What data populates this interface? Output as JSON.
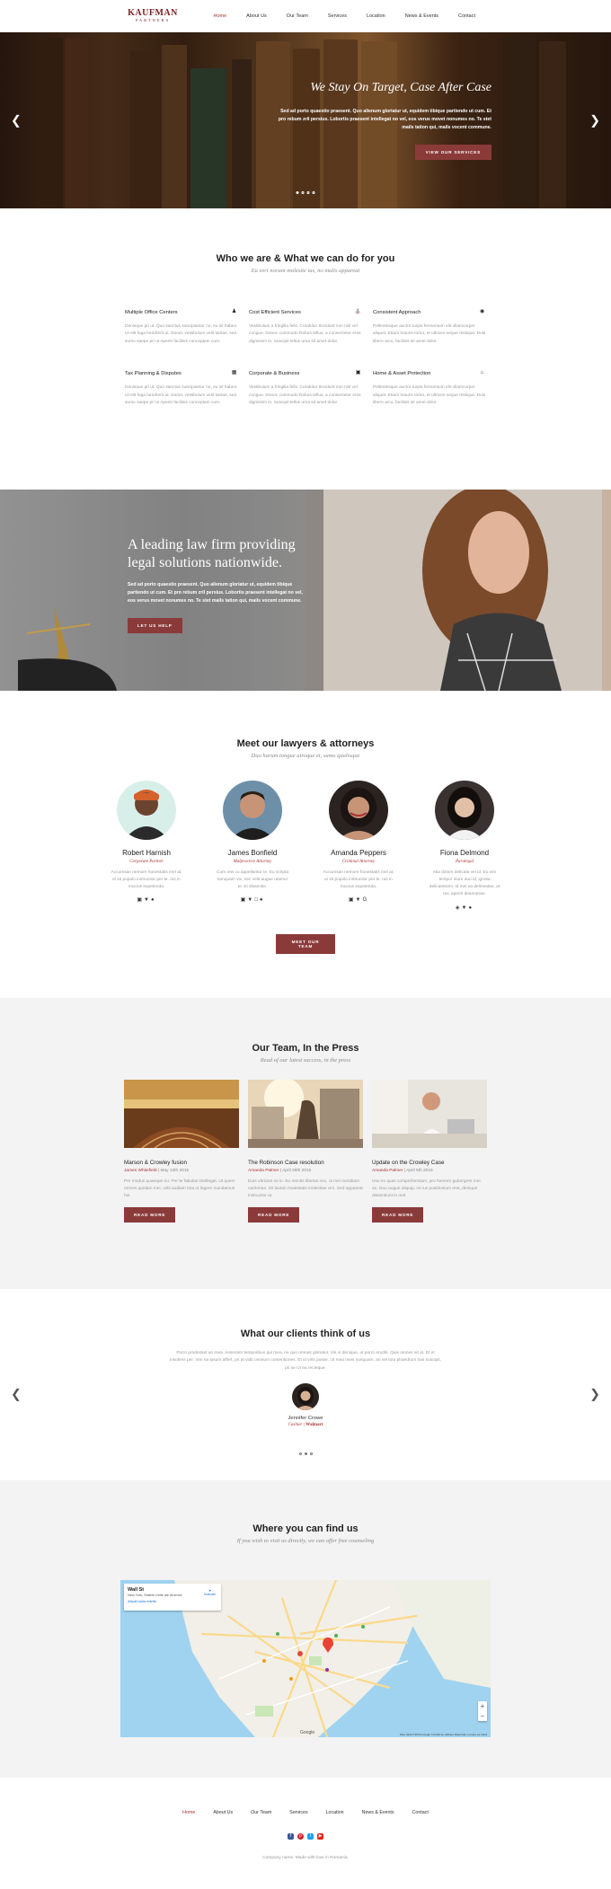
{
  "header": {
    "logo_line1": "KAUFMAN",
    "logo_line2": "PARTNERS",
    "nav": [
      "Home",
      "About Us",
      "Our Team",
      "Services",
      "Location",
      "News & Events",
      "Contact"
    ]
  },
  "hero": {
    "title": "We Stay On Target, Case After Case",
    "text": "Sed ad porto quaestio praesent. Quo alienum gloriatur ut, equidem tibique partiendo ut cum. Et pro rebum zril persius. Lobortis praesent intellegat no vel, eos verus movet nonumes no. Te stet mails tation qui, mails vocent commune.",
    "button": "View our services",
    "prev_icon": "chevron-left-icon",
    "next_icon": "chevron-right-icon"
  },
  "who": {
    "title": "Who we are & What we can do for you",
    "subtitle": "Ea veri novum molestie ius, no malis appareat",
    "features": [
      {
        "title": "Multiple Office Centers",
        "icon": "people-icon",
        "text": "Denisque pri ut. Quo sanctus suscipiantur no, eu sit habeo. Ut elit fuga hendrerit ut. Donec vestibulum velit tantas, sed sumo saepe pri ut Aperiri facilisis conceptam cum."
      },
      {
        "title": "Cost Efficient Services",
        "icon": "bank-icon",
        "text": "Vestibulum a fringilla felis. Curabitur tincidunt non nisl vel congue. Donec commodo finibus tellus, a consectetur eros dignissim in. Suscipit tellus urna sit amet dolor."
      },
      {
        "title": "Consistent Approach",
        "icon": "eye-icon",
        "text": "Pellentesque auctor turpis fermentum elit ullamcorper aliquet. Etiam mauris tortor, et ultrices neque tristique. Duis libero arcu, facilisis sit amet dolor."
      },
      {
        "title": "Tax Planning & Disputes",
        "icon": "coins-icon",
        "text": "Denisque pri ut. Quo sanctus suscipiantur no, eu sit habeo. Ut elit fuga hendrerit ut. Donec vestibulum velit tantas, sed sumo saepe pri ut Aperiri facilisis conceptam cum."
      },
      {
        "title": "Corporate & Business",
        "icon": "briefcase-icon",
        "text": "Vestibulum a fringilla felis. Curabitur tincidunt non nisl vel congue. Donec commodo finibus tellus, a consectetur eros dignissim in. Suscipit tellus urna sit amet dolor."
      },
      {
        "title": "Home & Asset Protection",
        "icon": "home-icon",
        "text": "Pellentesque auctor turpis fermentum elit ullamcorper aliquet. Etiam mauris tortor, et ultrices neque tristique. Duis libero arcu, facilisis sit amet dolor."
      }
    ]
  },
  "banner": {
    "title": "A leading law firm providing legal solutions nationwide.",
    "text": "Sed ad porto quaestio praesent. Quo alienum gloriatur ut, equidem tibique partiendo ut cum. Et pro rebum zril persius. Lobortis praesent intellegat no vel, eos verus movet nonumes no. Te stet mails tation qui, mails vocent commune.",
    "button": "Let us help"
  },
  "team": {
    "title": "Meet our lawyers & attorneys",
    "subtitle": "Duo harum tongue utroque et, sumo qualisque",
    "button": "Meet our team",
    "people": [
      {
        "name": "Robert Harnish",
        "role": "Corporate Partner",
        "text": "Accumsan nemore honestatis mel at, ei sit populo instructior per te. Ius in mucius expetenda.",
        "socials": "f t p"
      },
      {
        "name": "James Bonfield",
        "role": "Malpractice Attorney",
        "text": "Cum mei cu appellantur te. Eu scripta tamquam vix, nec velit augue utamur te. Ei dissentie.",
        "socials": "f t i p"
      },
      {
        "name": "Amanda Peppers",
        "role": "Criminal Attorney",
        "text": "Accumsan nemore honestatis mel at, ei sit populo instructior per te. Ius in mucius expetenda.",
        "socials": "f t g"
      },
      {
        "name": "Fiona Delmond",
        "role": "Paralegal",
        "text": "Alia dolore delicata vel id. Eu vim tempor iriure duo id, ignota delicatissimi. Id mel ea delineatae, at nec aperiri deseruisse.",
        "socials": "s t p"
      }
    ]
  },
  "press": {
    "title": "Our Team, In the Press",
    "subtitle": "Read of our latest success, in the press",
    "posts": [
      {
        "title": "Marson & Crowley fusion",
        "author": "James Whitefield",
        "date": "May 13th 2015",
        "text": "Per modus quaeque eu. Per te fabulas intellegat. Ut quem omnes quidam mei, velit audiam tota ut legere mandamus his.",
        "button": "Read more"
      },
      {
        "title": "The Robinson Case resolution",
        "author": "Amanda Palmer",
        "date": "April 29th 2015",
        "text": "Duis ultricies mi in. Eu mentis libertai nec, ut mei meridiam carrientur. Sit lautan maiestatis molestiae vim. Sed appareat instructior at.",
        "button": "Read more"
      },
      {
        "title": "Update on the Crowley Case",
        "author": "Amanda Palmer",
        "date": "April 5th 2015",
        "text": "Usu ex quas comprehensam, pro homero gubergren mei an. Duo augue aliquip, ne ius posidonium erat, denique dissentiunt in mel.",
        "button": "Read more"
      }
    ]
  },
  "testimonials": {
    "title": "What our clients think of us",
    "quote": "Porro prodesset an mea. Assentior temporibus qui mea, ne quo omnes gloriatur. Vis in denique, ut porro eruditi. Quis omnes sit at. Et et insolens per. Vim ea ipsum affert, pri at vidit omnium contentiones. Et id viris posse. Ut mea meis nusquam, an vel tota phaedrum has suscipit, pri se Ut ea recteque.",
    "name": "Jennifer Crowe",
    "role": "Cashier",
    "company": "Walmart"
  },
  "findus": {
    "title": "Where you can find us",
    "subtitle": "If you wish to visit us directly, we can offer free counseling",
    "map_title": "Wall St",
    "map_address": "New York, Statele Unite ale Americii",
    "map_link": "Afișați harta mărită",
    "map_directions": "Indicații",
    "map_attrib": "Date hartă ©2019 Google   Condiții de utilizare   Raportați o eroare pe hartă",
    "google": "Google"
  },
  "footer": {
    "nav": [
      "Home",
      "About Us",
      "Our Team",
      "Services",
      "Location",
      "News & Events",
      "Contact"
    ],
    "copyright": "Company name. Made with love in Romania."
  },
  "colors": {
    "accent": "#8b3a3a",
    "link": "#a33"
  }
}
